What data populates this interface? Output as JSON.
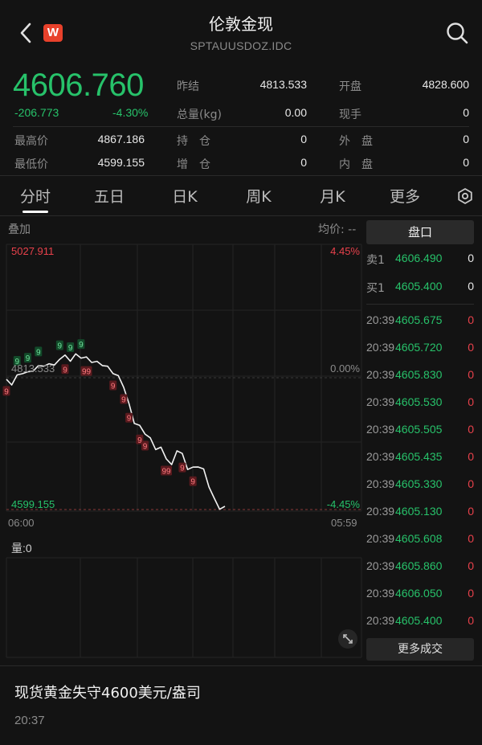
{
  "header": {
    "title": "伦敦金现",
    "subtitle": "SPTAUUSDOZ.IDC",
    "logo_text": "W",
    "back_icon": "chevron-left-icon",
    "search_icon": "search-icon"
  },
  "quote": {
    "price": "4606.760",
    "change": "-206.773",
    "change_pct": "-4.30%",
    "fields": {
      "prev_close_label": "昨结",
      "prev_close": "4813.533",
      "open_label": "开盘",
      "open": "4828.600",
      "volume_label": "总量(kg)",
      "volume": "0.00",
      "hand_label": "现手",
      "hand": "0",
      "high_label": "最高价",
      "high": "4867.186",
      "position_label": "持　仓",
      "position": "0",
      "outer_label": "外　盘",
      "outer": "0",
      "low_label": "最低价",
      "low": "4599.155",
      "increase_label": "增　仓",
      "increase": "0",
      "inner_label": "内　盘",
      "inner": "0"
    }
  },
  "tabs": [
    "分时",
    "五日",
    "日K",
    "周K",
    "月K",
    "更多"
  ],
  "active_tab": "分时",
  "settings_icon": "gear-icon",
  "chart": {
    "overlay_label": "叠加",
    "avg_label": "均价: --",
    "top_price": "5027.911",
    "top_pct": "4.45%",
    "mid_price": "4813.533",
    "mid_pct": "0.00%",
    "bottom_price": "4599.155",
    "bottom_pct": "-4.45%",
    "time_start": "06:00",
    "time_end": "05:59",
    "volume_label": "量:0",
    "expand_icon": "expand-icon"
  },
  "chart_data": {
    "type": "line",
    "ylim": [
      4599.155,
      5027.911
    ],
    "x_start": "06:00",
    "x_end": "05:59",
    "series": [
      {
        "values": [
          4813,
          4800,
          4820,
          4818,
          4825,
          4822,
          4835,
          4830,
          4838,
          4832,
          4845,
          4848,
          4842,
          4850,
          4847,
          4845,
          4840,
          4838,
          4835,
          4830,
          4822,
          4815,
          4800,
          4770,
          4742,
          4735,
          4725,
          4715,
          4700,
          4700,
          4685,
          4672,
          4698,
          4690,
          4668,
          4668,
          4672,
          4665,
          4640,
          4618,
          4604,
          4605
        ]
      }
    ],
    "markers": [
      {
        "label": "9",
        "kind": "buy"
      },
      {
        "label": "9",
        "kind": "buy"
      },
      {
        "label": "9",
        "kind": "buy"
      },
      {
        "label": "9",
        "kind": "buy"
      },
      {
        "label": "9",
        "kind": "buy"
      },
      {
        "label": "9",
        "kind": "buy"
      },
      {
        "label": "9",
        "kind": "sell"
      },
      {
        "label": "9",
        "kind": "sell"
      },
      {
        "label": "99",
        "kind": "sell"
      },
      {
        "label": "9",
        "kind": "sell"
      },
      {
        "label": "9",
        "kind": "sell"
      },
      {
        "label": "9",
        "kind": "sell"
      },
      {
        "label": "9",
        "kind": "sell"
      },
      {
        "label": "9",
        "kind": "sell"
      },
      {
        "label": "99",
        "kind": "sell"
      },
      {
        "label": "9",
        "kind": "sell"
      },
      {
        "label": "9",
        "kind": "sell"
      }
    ]
  },
  "orderbook": {
    "title": "盘口",
    "ask_label": "卖1",
    "ask_price": "4606.490",
    "ask_vol": "0",
    "bid_label": "买1",
    "bid_price": "4605.400",
    "bid_vol": "0"
  },
  "trades": [
    {
      "time": "20:39",
      "price": "4605.675",
      "vol": "0"
    },
    {
      "time": "20:39",
      "price": "4605.720",
      "vol": "0"
    },
    {
      "time": "20:39",
      "price": "4605.830",
      "vol": "0"
    },
    {
      "time": "20:39",
      "price": "4605.530",
      "vol": "0"
    },
    {
      "time": "20:39",
      "price": "4605.505",
      "vol": "0"
    },
    {
      "time": "20:39",
      "price": "4605.435",
      "vol": "0"
    },
    {
      "time": "20:39",
      "price": "4605.330",
      "vol": "0"
    },
    {
      "time": "20:39",
      "price": "4605.130",
      "vol": "0"
    },
    {
      "time": "20:39",
      "price": "4605.608",
      "vol": "0"
    },
    {
      "time": "20:39",
      "price": "4605.860",
      "vol": "0"
    },
    {
      "time": "20:39",
      "price": "4606.050",
      "vol": "0"
    },
    {
      "time": "20:39",
      "price": "4605.400",
      "vol": "0"
    }
  ],
  "more_trades_label": "更多成交",
  "news": {
    "title": "现货黄金失守4600美元/盎司",
    "time": "20:37"
  },
  "colors": {
    "up": "#e8414b",
    "down": "#27c26a",
    "background": "#131313"
  }
}
